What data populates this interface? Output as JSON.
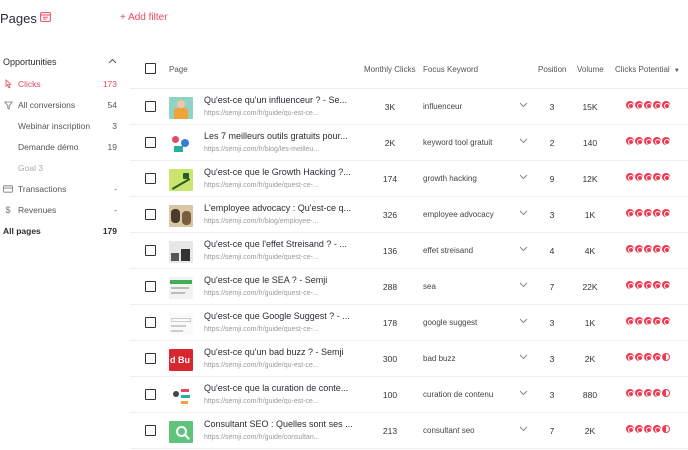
{
  "header": {
    "title": "Pages",
    "add_filter": "+ Add filter"
  },
  "sidebar": {
    "section_title": "Opportunities",
    "items": [
      {
        "label": "Clicks",
        "count": "173",
        "icon": "cursor-icon",
        "state": "active"
      },
      {
        "label": "All conversions",
        "count": "54",
        "icon": "funnel-icon",
        "state": "normal"
      },
      {
        "label": "Webinar inscription",
        "count": "3",
        "icon": "",
        "state": "normal"
      },
      {
        "label": "Demande démo",
        "count": "19",
        "icon": "",
        "state": "normal"
      },
      {
        "label": "Goal 3",
        "count": "",
        "icon": "",
        "state": "muted"
      },
      {
        "label": "Transactions",
        "count": "-",
        "icon": "card-icon",
        "state": "normal"
      },
      {
        "label": "Revenues",
        "count": "-",
        "icon": "dollar-icon",
        "state": "normal"
      }
    ],
    "all_pages": {
      "label": "All pages",
      "count": "179"
    }
  },
  "table": {
    "columns": {
      "page": "Page",
      "clicks": "Monthly Clicks",
      "keyword": "Focus Keyword",
      "position": "Position",
      "volume": "Volume",
      "potential": "Clicks Potential"
    },
    "rows": [
      {
        "title": "Qu'est-ce qu'un influenceur ? - Se...",
        "url": "https://semji.com/fr/guide/qu-est-ce...",
        "clicks": "3K",
        "keyword": "influenceur",
        "position": "3",
        "volume": "15K",
        "potential": 5,
        "thumb": "influencer"
      },
      {
        "title": "Les 7 meilleurs outils gratuits pour...",
        "url": "https://semji.com/fr/blog/les-meilleu...",
        "clicks": "2K",
        "keyword": "keyword tool gratuit",
        "position": "2",
        "volume": "140",
        "potential": 5,
        "thumb": "tools"
      },
      {
        "title": "Qu'est-ce que le Growth Hacking ?...",
        "url": "https://semji.com/fr/guide/quest-ce-...",
        "clicks": "174",
        "keyword": "growth hacking",
        "position": "9",
        "volume": "12K",
        "potential": 5,
        "thumb": "growth"
      },
      {
        "title": "L'employee advocacy : Qu'est-ce q...",
        "url": "https://semji.com/fr/blog/employee-...",
        "clicks": "326",
        "keyword": "employee advocacy",
        "position": "3",
        "volume": "1K",
        "potential": 5,
        "thumb": "advocacy"
      },
      {
        "title": "Qu'est-ce que l'effet Streisand ? - ...",
        "url": "https://semji.com/fr/guide/quest-ce-...",
        "clicks": "136",
        "keyword": "effet streisand",
        "position": "4",
        "volume": "4K",
        "potential": 5,
        "thumb": "streisand"
      },
      {
        "title": "Qu'est-ce que le SEA ? - Semji",
        "url": "https://semji.com/fr/guide/quest-ce-...",
        "clicks": "288",
        "keyword": "sea",
        "position": "7",
        "volume": "22K",
        "potential": 5,
        "thumb": "sea"
      },
      {
        "title": "Qu'est-ce que Google Suggest ? - ...",
        "url": "https://semji.com/fr/guide/quest-ce-...",
        "clicks": "178",
        "keyword": "google suggest",
        "position": "3",
        "volume": "1K",
        "potential": 5,
        "thumb": "suggest"
      },
      {
        "title": "Qu'est-ce qu'un bad buzz ? - Semji",
        "url": "https://semji.com/fr/guide/qu-est-ce...",
        "clicks": "300",
        "keyword": "bad buzz",
        "position": "3",
        "volume": "2K",
        "potential": 4.5,
        "thumb": "badbuzz"
      },
      {
        "title": "Qu'est-ce que la curation de conte...",
        "url": "https://semji.com/fr/guide/qu-est-ce...",
        "clicks": "100",
        "keyword": "curation de contenu",
        "position": "3",
        "volume": "880",
        "potential": 4.5,
        "thumb": "curation"
      },
      {
        "title": "Consultant SEO : Quelles sont ses ...",
        "url": "https://semji.com/fr/guide/consultan...",
        "clicks": "213",
        "keyword": "consultant seo",
        "position": "7",
        "volume": "2K",
        "potential": 4.5,
        "thumb": "consultant"
      }
    ]
  },
  "colors": {
    "accent": "#e8495f",
    "dot": "#ee3b52"
  }
}
